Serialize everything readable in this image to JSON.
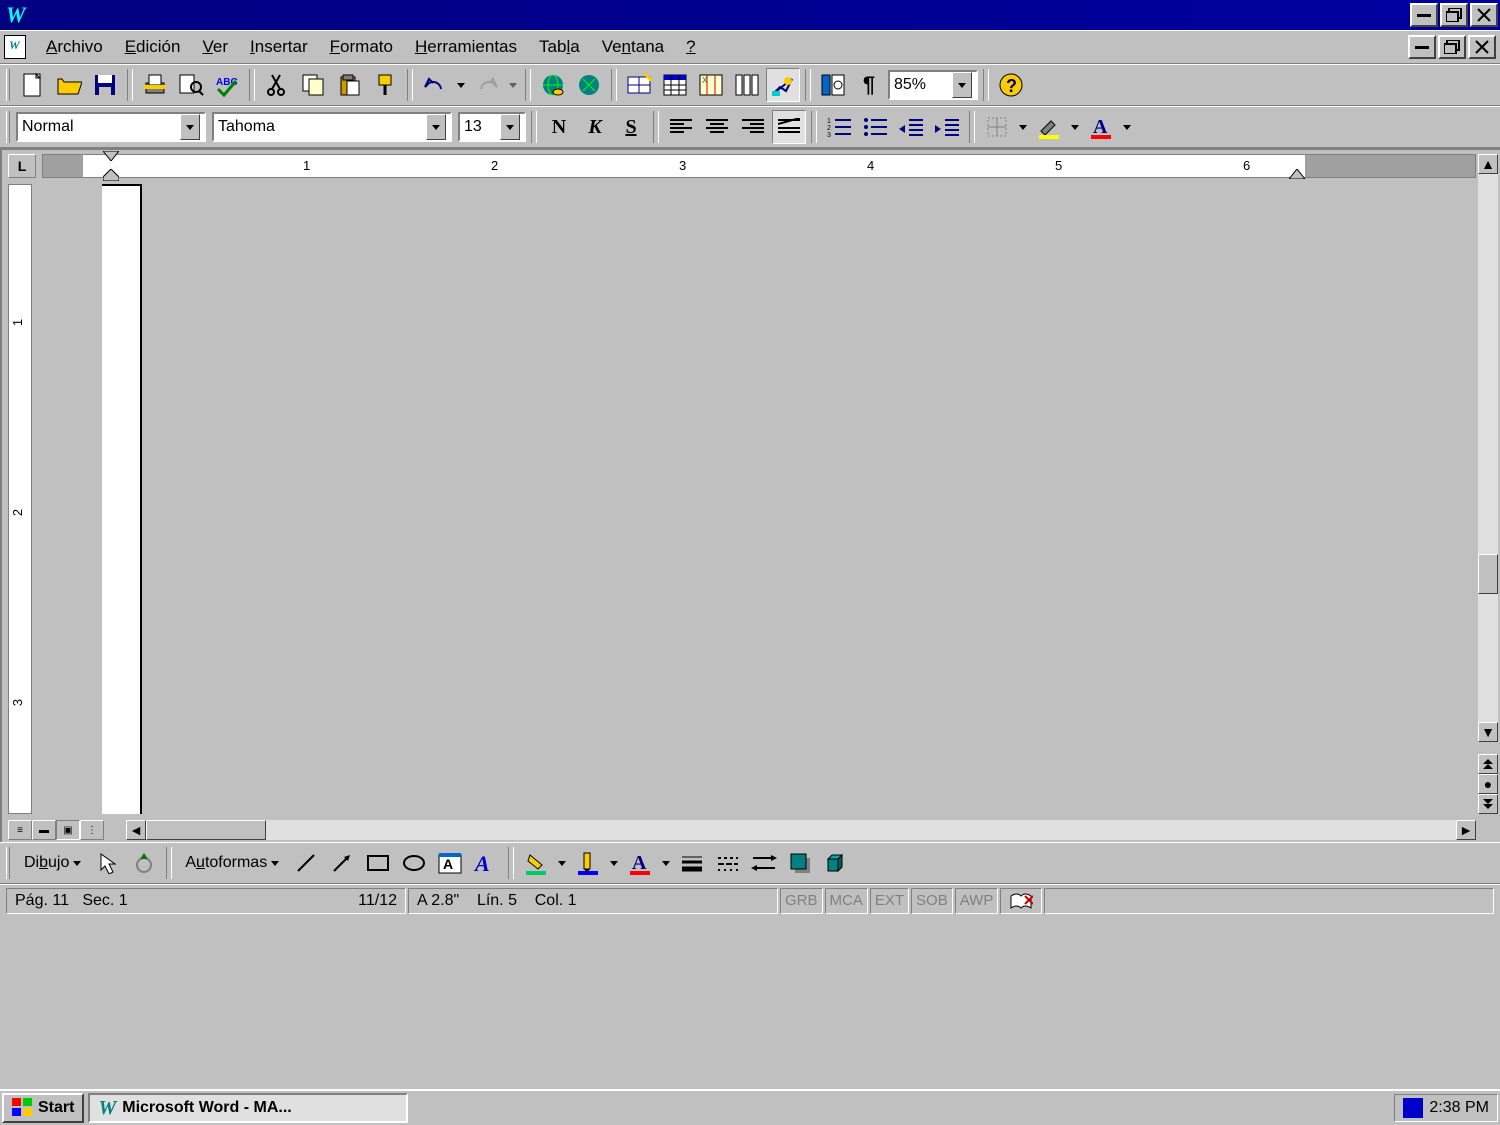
{
  "titlebar": {
    "app_letter": "W"
  },
  "menu": {
    "items": [
      "Archivo",
      "Edición",
      "Ver",
      "Insertar",
      "Formato",
      "Herramientas",
      "Tabla",
      "Ventana",
      "?"
    ],
    "accel": [
      "A",
      "E",
      "V",
      "I",
      "F",
      "H",
      "l",
      "V",
      ""
    ]
  },
  "toolbar1": {
    "zoom": "85%"
  },
  "toolbar2": {
    "style": "Normal",
    "font": "Tahoma",
    "size": "13"
  },
  "ruler": {
    "nums": [
      "1",
      "2",
      "3",
      "4",
      "5",
      "6"
    ]
  },
  "vruler": {
    "nums": [
      "1",
      "2",
      "3"
    ]
  },
  "drawbar": {
    "dibujo": "Dibujo",
    "autoformas": "Autoformas"
  },
  "status": {
    "page": "Pág. 11",
    "sec": "Sec. 1",
    "pages": "11/12",
    "at": "A 2.8\"",
    "line": "Lín. 5",
    "col": "Col. 1",
    "indicators": [
      "GRB",
      "MCA",
      "EXT",
      "SOB",
      "AWP"
    ]
  },
  "taskbar": {
    "start": "Start",
    "task": "Microsoft Word - MA...",
    "clock": "2:38 PM"
  }
}
